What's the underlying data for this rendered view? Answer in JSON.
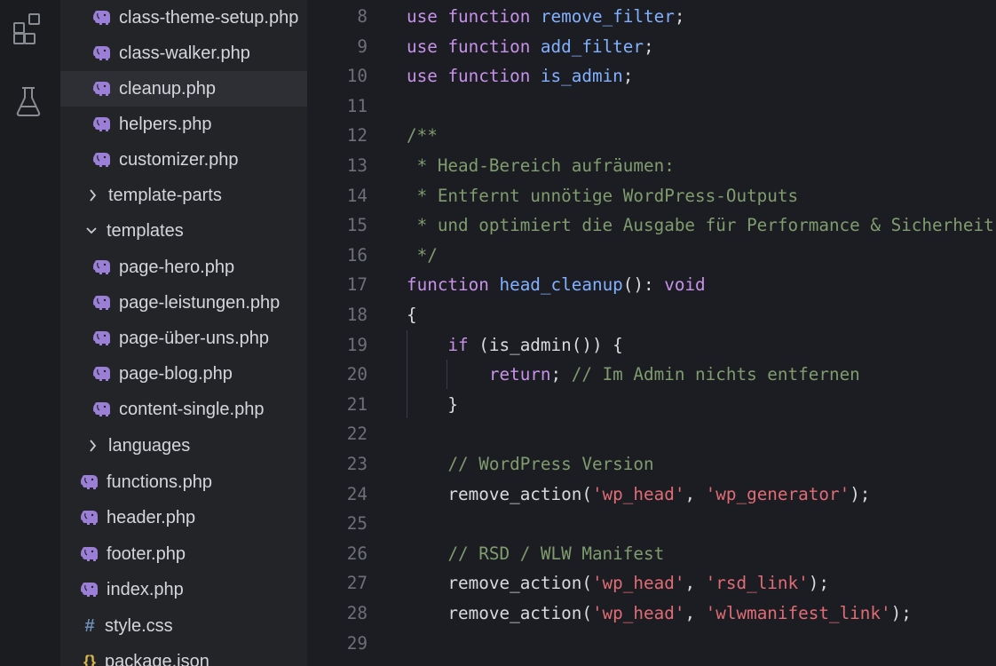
{
  "colors": {
    "background": "#1c1d22",
    "sidebar": "#232428",
    "keyword": "#c792ea",
    "function": "#82b1ff",
    "comment": "#7f9c6e",
    "string": "#e06c75",
    "php_icon": "#9b7fd6"
  },
  "activity_bar": {
    "icons": [
      "extensions-icon",
      "flask-icon"
    ]
  },
  "explorer": {
    "items": [
      {
        "label": "class-theme-setup.php",
        "type": "php",
        "icon": "elephant-icon"
      },
      {
        "label": "class-walker.php",
        "type": "php",
        "icon": "elephant-icon"
      },
      {
        "label": "cleanup.php",
        "type": "php",
        "icon": "elephant-icon",
        "active": true
      },
      {
        "label": "helpers.php",
        "type": "php",
        "icon": "elephant-icon"
      },
      {
        "label": "customizer.php",
        "type": "php",
        "icon": "elephant-icon"
      },
      {
        "label": "template-parts",
        "type": "folder",
        "icon": "chevron-right-icon"
      },
      {
        "label": "templates",
        "type": "folder",
        "icon": "chevron-down-icon"
      },
      {
        "label": "page-hero.php",
        "type": "php",
        "icon": "elephant-icon"
      },
      {
        "label": "page-leistungen.php",
        "type": "php",
        "icon": "elephant-icon"
      },
      {
        "label": "page-über-uns.php",
        "type": "php",
        "icon": "elephant-icon"
      },
      {
        "label": "page-blog.php",
        "type": "php",
        "icon": "elephant-icon"
      },
      {
        "label": "content-single.php",
        "type": "php",
        "icon": "elephant-icon"
      },
      {
        "label": "languages",
        "type": "folder",
        "icon": "chevron-right-icon"
      },
      {
        "label": "functions.php",
        "type": "php",
        "icon": "elephant-icon"
      },
      {
        "label": "header.php",
        "type": "php",
        "icon": "elephant-icon"
      },
      {
        "label": "footer.php",
        "type": "php",
        "icon": "elephant-icon"
      },
      {
        "label": "index.php",
        "type": "php",
        "icon": "elephant-icon"
      },
      {
        "label": "style.css",
        "type": "css",
        "icon": "hash-icon",
        "glyph": "#"
      },
      {
        "label": "package.json",
        "type": "json",
        "icon": "braces-icon",
        "glyph": "{}"
      }
    ]
  },
  "editor": {
    "lines": [
      {
        "n": "8",
        "tokens": [
          [
            "kw",
            "use"
          ],
          [
            "pl",
            " "
          ],
          [
            "kw",
            "function"
          ],
          [
            "pl",
            " "
          ],
          [
            "fn",
            "remove_filter"
          ],
          [
            "pl",
            ";"
          ]
        ]
      },
      {
        "n": "9",
        "tokens": [
          [
            "kw",
            "use"
          ],
          [
            "pl",
            " "
          ],
          [
            "kw",
            "function"
          ],
          [
            "pl",
            " "
          ],
          [
            "fn",
            "add_filter"
          ],
          [
            "pl",
            ";"
          ]
        ]
      },
      {
        "n": "10",
        "tokens": [
          [
            "kw",
            "use"
          ],
          [
            "pl",
            " "
          ],
          [
            "kw",
            "function"
          ],
          [
            "pl",
            " "
          ],
          [
            "fn",
            "is_admin"
          ],
          [
            "pl",
            ";"
          ]
        ]
      },
      {
        "n": "11",
        "tokens": []
      },
      {
        "n": "12",
        "tokens": [
          [
            "cm",
            "/**"
          ]
        ]
      },
      {
        "n": "13",
        "tokens": [
          [
            "cm",
            " * Head-Bereich aufräumen:"
          ]
        ]
      },
      {
        "n": "14",
        "tokens": [
          [
            "cm",
            " * Entfernt unnötige WordPress-Outputs"
          ]
        ]
      },
      {
        "n": "15",
        "tokens": [
          [
            "cm",
            " * und optimiert die Ausgabe für Performance & Sicherheit."
          ]
        ]
      },
      {
        "n": "16",
        "tokens": [
          [
            "cm",
            " */"
          ]
        ]
      },
      {
        "n": "17",
        "tokens": [
          [
            "kw",
            "function"
          ],
          [
            "pl",
            " "
          ],
          [
            "fn",
            "head_cleanup"
          ],
          [
            "pl",
            "(): "
          ],
          [
            "kw",
            "void"
          ]
        ]
      },
      {
        "n": "18",
        "tokens": [
          [
            "pl",
            "{"
          ]
        ]
      },
      {
        "n": "19",
        "tokens": [
          [
            "pl",
            "    "
          ],
          [
            "kw",
            "if"
          ],
          [
            "pl",
            " (is_admin()) {"
          ]
        ]
      },
      {
        "n": "20",
        "tokens": [
          [
            "pl",
            "        "
          ],
          [
            "kw",
            "return"
          ],
          [
            "pl",
            "; "
          ],
          [
            "cm",
            "// Im Admin nichts entfernen"
          ]
        ]
      },
      {
        "n": "21",
        "tokens": [
          [
            "pl",
            "    }"
          ]
        ]
      },
      {
        "n": "22",
        "tokens": []
      },
      {
        "n": "23",
        "tokens": [
          [
            "pl",
            "    "
          ],
          [
            "cm",
            "// WordPress Version"
          ]
        ]
      },
      {
        "n": "24",
        "tokens": [
          [
            "pl",
            "    remove_action("
          ],
          [
            "st",
            "'wp_head'"
          ],
          [
            "pl",
            ", "
          ],
          [
            "st",
            "'wp_generator'"
          ],
          [
            "pl",
            ");"
          ]
        ]
      },
      {
        "n": "25",
        "tokens": []
      },
      {
        "n": "26",
        "tokens": [
          [
            "pl",
            "    "
          ],
          [
            "cm",
            "// RSD / WLW Manifest"
          ]
        ]
      },
      {
        "n": "27",
        "tokens": [
          [
            "pl",
            "    remove_action("
          ],
          [
            "st",
            "'wp_head'"
          ],
          [
            "pl",
            ", "
          ],
          [
            "st",
            "'rsd_link'"
          ],
          [
            "pl",
            ");"
          ]
        ]
      },
      {
        "n": "28",
        "tokens": [
          [
            "pl",
            "    remove_action("
          ],
          [
            "st",
            "'wp_head'"
          ],
          [
            "pl",
            ", "
          ],
          [
            "st",
            "'wlwmanifest_link'"
          ],
          [
            "pl",
            ");"
          ]
        ]
      },
      {
        "n": "29",
        "tokens": []
      }
    ]
  }
}
